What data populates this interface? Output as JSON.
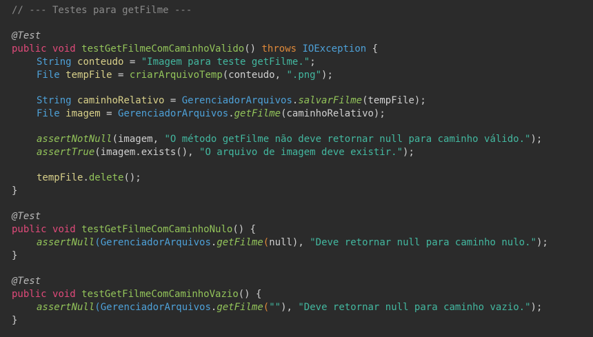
{
  "code": {
    "comment": "// --- Testes para getFilme ---",
    "test1": {
      "annotation": "@Test",
      "kw_public": "public",
      "kw_void": "void",
      "method_name": "testGetFilmeComCaminhoValido",
      "paren": "()",
      "kw_throws": "throws",
      "exception": "IOException",
      "open_brace": "{",
      "line1": {
        "type": "String",
        "var": "conteudo",
        "op": " = ",
        "str": "\"Imagem para teste getFilme.\"",
        "end": ";"
      },
      "line2": {
        "type": "File",
        "var": "tempFile",
        "op": " = ",
        "call": "criarArquivoTemp",
        "args_open": "(conteudo, ",
        "str": "\".png\"",
        "end": ");"
      },
      "line3": {
        "type": "String",
        "var": "caminhoRelativo",
        "op": " = ",
        "cls": "GerenciadorArquivos",
        "dot": ".",
        "call": "salvarFilme",
        "args": "(tempFile);"
      },
      "line4": {
        "type": "File",
        "var": "imagem",
        "op": " = ",
        "cls": "GerenciadorArquivos",
        "dot": ".",
        "call": "getFilme",
        "args": "(caminhoRelativo);"
      },
      "line5": {
        "call": "assertNotNull",
        "args_open": "(imagem, ",
        "str": "\"O método getFilme não deve retornar null para caminho válido.\"",
        "end": ");"
      },
      "line6": {
        "call": "assertTrue",
        "args_open": "(imagem.exists(), ",
        "str": "\"O arquivo de imagem deve existir.\"",
        "end": ");"
      },
      "line7": {
        "var": "tempFile",
        "dot": ".",
        "call": "delete",
        "end": "();"
      },
      "close_brace": "}"
    },
    "test2": {
      "annotation": "@Test",
      "kw_public": "public",
      "kw_void": "void",
      "method_name": "testGetFilmeComCaminhoNulo",
      "sig_end": "() {",
      "line1": {
        "call": "assertNull",
        "p_open": "(",
        "cls": "GerenciadorArquivos",
        "dot": ".",
        "call2": "getFilme",
        "p2": "(",
        "null": "null",
        "p3": "), ",
        "str": "\"Deve retornar null para caminho nulo.\"",
        "end": ");"
      },
      "close_brace": "}"
    },
    "test3": {
      "annotation": "@Test",
      "kw_public": "public",
      "kw_void": "void",
      "method_name": "testGetFilmeComCaminhoVazio",
      "sig_end": "() {",
      "line1": {
        "call": "assertNull",
        "p_open": "(",
        "cls": "GerenciadorArquivos",
        "dot": ".",
        "call2": "getFilme",
        "p2": "(",
        "str1": "\"\"",
        "p3": "), ",
        "str": "\"Deve retornar null para caminho vazio.\"",
        "end": ");"
      },
      "close_brace": "}"
    }
  },
  "colors": {
    "background": "#2b2b2b",
    "comment": "#8a8a8a",
    "keyword": "#e04a7a",
    "type": "#4ea1d8",
    "method": "#93c45a",
    "variable": "#d8d08a",
    "string": "#43b8a0",
    "throws_null": "#e08a3a"
  }
}
